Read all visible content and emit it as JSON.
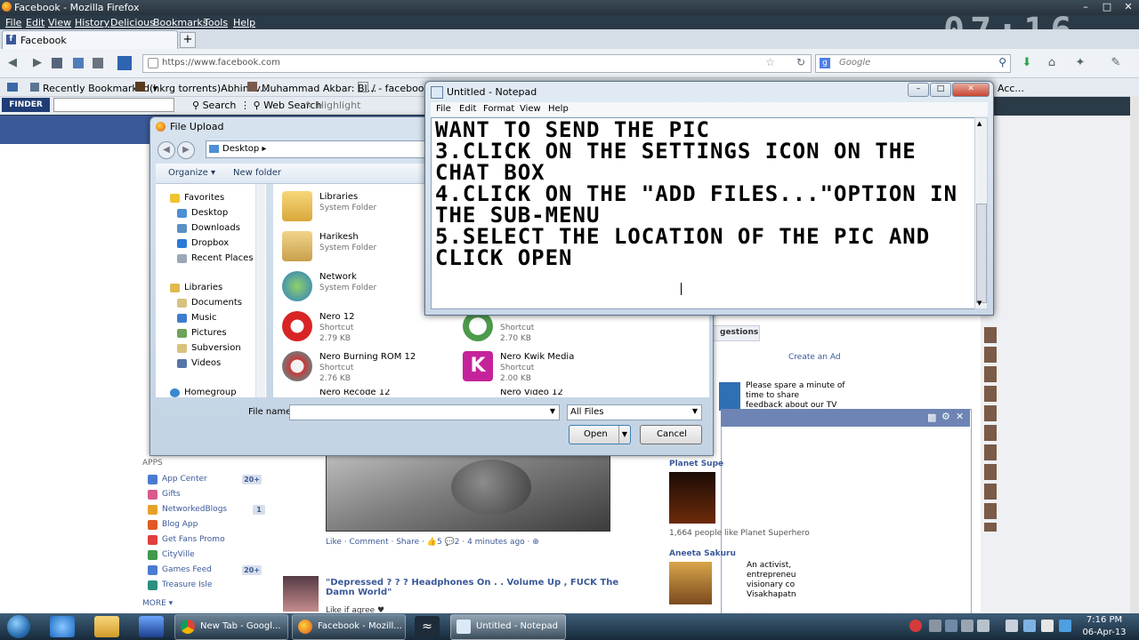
{
  "firefox": {
    "title": "Facebook - Mozilla Firefox",
    "menu": [
      "File",
      "Edit",
      "View",
      "History",
      "Delicious",
      "Bookmarks",
      "Tools",
      "Help"
    ],
    "window_controls": [
      "–",
      "□",
      "✕"
    ],
    "tab_label": "Facebook",
    "new_tab": "+",
    "url": "https://www.facebook.com",
    "search_placeholder": "Google",
    "bookmarks": [
      "Recently Bookmarked ▾",
      "(hkrg torrents)Abhinav...",
      "Muhammad Akbar: Bl...",
      "/ - facebook-",
      "Acc..."
    ],
    "toolbar2": {
      "finder": "FINDER",
      "search": "Search",
      "web_search": "Web Search",
      "highlight": "Highlight"
    }
  },
  "clock_overlay": "07:16",
  "file_upload": {
    "title": "File Upload",
    "address": "Desktop ▸",
    "organize": "Organize ▾",
    "new_folder": "New folder",
    "nav": {
      "favorites": "Favorites",
      "fav_items": [
        "Desktop",
        "Downloads",
        "Dropbox",
        "Recent Places"
      ],
      "libraries": "Libraries",
      "lib_items": [
        "Documents",
        "Music",
        "Pictures",
        "Subversion",
        "Videos"
      ],
      "homegroup": "Homegroup"
    },
    "files": [
      {
        "name": "Libraries",
        "type": "System Folder",
        "size": ""
      },
      {
        "name": "Harikesh",
        "type": "System Folder",
        "size": ""
      },
      {
        "name": "Network",
        "type": "System Folder",
        "size": ""
      },
      {
        "name": "Nero 12",
        "type": "Shortcut",
        "size": "2.79 KB"
      },
      {
        "name": "",
        "type": "Shortcut",
        "size": "2.70 KB"
      },
      {
        "name": "Nero Burning ROM 12",
        "type": "Shortcut",
        "size": "2.76 KB"
      },
      {
        "name": "Nero Kwik Media",
        "type": "Shortcut",
        "size": "2.00 KB"
      },
      {
        "name": "Nero Recode 12",
        "type": "",
        "size": ""
      },
      {
        "name": "Nero Video 12",
        "type": "",
        "size": ""
      }
    ],
    "file_name_label": "File name:",
    "file_name_value": "",
    "filter": "All Files",
    "open": "Open",
    "cancel": "Cancel"
  },
  "notepad": {
    "title": "Untitled - Notepad",
    "menu": [
      "File",
      "Edit",
      "Format",
      "View",
      "Help"
    ],
    "text": "WANT TO SEND THE PIC\n3.CLICK ON THE SETTINGS ICON ON THE CHAT BOX\n4.CLICK ON THE \"ADD FILES...\"OPTION IN THE SUB-MENU\n5.SELECT THE LOCATION OF THE PIC AND CLICK OPEN"
  },
  "facebook": {
    "apps_header": "APPS",
    "apps": [
      {
        "label": "App Center",
        "count": "20+",
        "color": "#4b7bd1"
      },
      {
        "label": "Gifts",
        "count": "",
        "color": "#d95a8b"
      },
      {
        "label": "NetworkedBlogs",
        "count": "1",
        "color": "#e6a12a"
      },
      {
        "label": "Blog App",
        "count": "",
        "color": "#e05a26"
      },
      {
        "label": "Get Fans Promo",
        "count": "",
        "color": "#e23f3f"
      },
      {
        "label": "CityVille",
        "count": "",
        "color": "#3f9a4a"
      },
      {
        "label": "Games Feed",
        "count": "20+",
        "color": "#4b7bd1"
      },
      {
        "label": "Treasure Isle",
        "count": "",
        "color": "#2d8f7f"
      }
    ],
    "more": "MORE ▾",
    "post_actions": "Like · Comment · Share · 👍5 💬2 · 4 minutes ago · ⊕",
    "post_title": "\"Depressed ? ? ? Headphones On . . Volume Up , FUCK The Damn World\"",
    "post_like": "Like if agree ♥",
    "suggestions": "gestions",
    "create_ad": "Create an Ad",
    "ad_text_1": "Please spare a minute of",
    "ad_text_2": "time to share",
    "ad_text_3": "feedback about our TV",
    "planet_title": "Planet Supe",
    "planet_likes": "1,664 people like Planet Superhero",
    "aneeta": "Aneeta Sakuru",
    "aneeta_1": "An activist,",
    "aneeta_2": "entrepreneu",
    "aneeta_3": "visionary co",
    "aneeta_4": "Visakhapatn"
  },
  "taskbar": {
    "buttons": [
      "New Tab - Googl...",
      "Facebook - Mozill...",
      "Untitled - Notepad"
    ],
    "time": "7:16 PM",
    "date": "06-Apr-13"
  }
}
